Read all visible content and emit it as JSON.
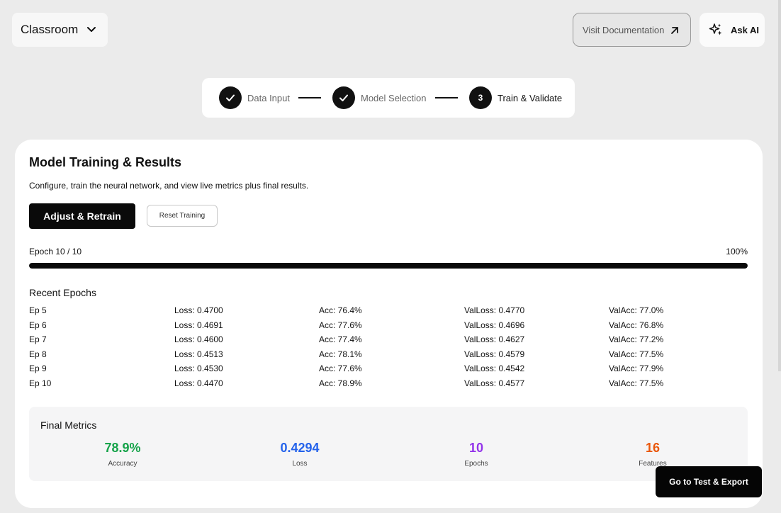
{
  "header": {
    "workspace_label": "Classroom",
    "docs_label": "Visit Documentation",
    "ai_label": "Ask AI"
  },
  "stepper": {
    "steps": [
      {
        "label": "Data Input",
        "state": "done"
      },
      {
        "label": "Model Selection",
        "state": "done"
      },
      {
        "label": "Train & Validate",
        "state": "active",
        "number": "3"
      }
    ]
  },
  "training": {
    "title": "Model Training & Results",
    "subtitle": "Configure, train the neural network, and view live metrics plus final results.",
    "retrain_label": "Adjust & Retrain",
    "reset_label": "Reset Training",
    "epoch_progress_label": "Epoch 10 / 10",
    "progress_percent_label": "100%",
    "progress_fraction": 1.0,
    "recent_title": "Recent Epochs",
    "epochs": [
      [
        "Ep 5",
        "Loss: 0.4700",
        "Acc: 76.4%",
        "ValLoss: 0.4770",
        "ValAcc: 77.0%"
      ],
      [
        "Ep 6",
        "Loss: 0.4691",
        "Acc: 77.6%",
        "ValLoss: 0.4696",
        "ValAcc: 76.8%"
      ],
      [
        "Ep 7",
        "Loss: 0.4600",
        "Acc: 77.4%",
        "ValLoss: 0.4627",
        "ValAcc: 77.2%"
      ],
      [
        "Ep 8",
        "Loss: 0.4513",
        "Acc: 78.1%",
        "ValLoss: 0.4579",
        "ValAcc: 77.5%"
      ],
      [
        "Ep 9",
        "Loss: 0.4530",
        "Acc: 77.6%",
        "ValLoss: 0.4542",
        "ValAcc: 77.9%"
      ],
      [
        "Ep 10",
        "Loss: 0.4470",
        "Acc: 78.9%",
        "ValLoss: 0.4577",
        "ValAcc: 77.5%"
      ]
    ]
  },
  "final_metrics": {
    "title": "Final Metrics",
    "items": [
      {
        "value": "78.9%",
        "label": "Accuracy",
        "color": "#16a34a"
      },
      {
        "value": "0.4294",
        "label": "Loss",
        "color": "#2563eb"
      },
      {
        "value": "10",
        "label": "Epochs",
        "color": "#9333ea"
      },
      {
        "value": "16",
        "label": "Features",
        "color": "#ea580c"
      }
    ]
  },
  "footer": {
    "go_label": "Go to Test & Export"
  },
  "colors": {
    "background": "#ebebeb",
    "accent": "#0a0a0a"
  },
  "icons": {
    "workspace_dropdown": "chevron-down-icon",
    "docs": "arrow-up-right-icon",
    "ai": "sparkles-icon",
    "step_done": "check-icon"
  }
}
